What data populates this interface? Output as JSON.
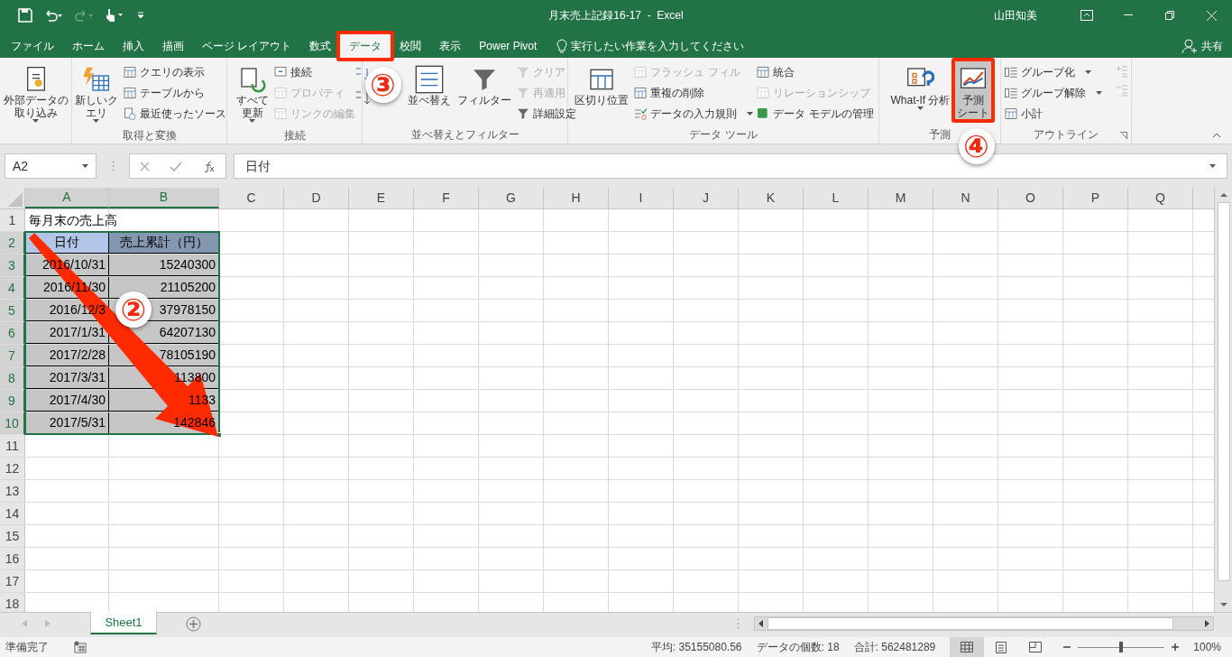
{
  "title_bar": {
    "title": "月末売上記録16-17  -  Excel",
    "user": "山田知美"
  },
  "tabs": [
    {
      "label": "ファイル",
      "selected": false
    },
    {
      "label": "ホーム",
      "selected": false
    },
    {
      "label": "挿入",
      "selected": false
    },
    {
      "label": "描画",
      "selected": false
    },
    {
      "label": "ページ レイアウト",
      "selected": false
    },
    {
      "label": "数式",
      "selected": false
    },
    {
      "label": "データ",
      "selected": true
    },
    {
      "label": "校閲",
      "selected": false
    },
    {
      "label": "表示",
      "selected": false
    },
    {
      "label": "Power Pivot",
      "selected": false
    }
  ],
  "tell_me": "実行したい作業を入力してください",
  "share": "共有",
  "ribbon": {
    "groups": [
      {
        "columns": [
          {
            "kind": "large",
            "lines": [
              "外部データの",
              "取り込み"
            ],
            "dropdown": true
          }
        ]
      },
      {
        "label": "取得と変換",
        "columns": [
          {
            "kind": "large",
            "lines": [
              "新しいク",
              "エリ"
            ],
            "dropdown": true
          },
          {
            "kind": "stack",
            "items": [
              {
                "label": "クエリの表示",
                "disabled": false,
                "dropdown": false
              },
              {
                "label": "テーブルから",
                "disabled": false,
                "dropdown": false
              },
              {
                "label": "最近使ったソース",
                "disabled": false,
                "dropdown": false
              }
            ]
          }
        ]
      },
      {
        "label": "接続",
        "columns": [
          {
            "kind": "large",
            "lines": [
              "すべて",
              "更新"
            ],
            "dropdown": true
          },
          {
            "kind": "stack",
            "items": [
              {
                "label": "接続",
                "disabled": false,
                "dropdown": false
              },
              {
                "label": "プロパティ",
                "disabled": true,
                "dropdown": false
              },
              {
                "label": "リンクの編集",
                "disabled": true,
                "dropdown": false
              }
            ]
          }
        ]
      },
      {
        "label": "並べ替えとフィルター",
        "columns": [
          {
            "kind": "sorticons"
          },
          {
            "kind": "large",
            "lines": [
              "並べ替え"
            ],
            "dropdown": false
          },
          {
            "kind": "large",
            "lines": [
              "フィルター"
            ],
            "dropdown": false
          },
          {
            "kind": "stack",
            "items": [
              {
                "label": "クリア",
                "disabled": true,
                "dropdown": false
              },
              {
                "label": "再適用",
                "disabled": true,
                "dropdown": false
              },
              {
                "label": "詳細設定",
                "disabled": false,
                "dropdown": false
              }
            ]
          }
        ]
      },
      {
        "label": "データ ツール",
        "columns": [
          {
            "kind": "large",
            "lines": [
              "区切り位置"
            ],
            "dropdown": false
          },
          {
            "kind": "stack",
            "items": [
              {
                "label": "フラッシュ フィル",
                "disabled": true,
                "dropdown": false
              },
              {
                "label": "重複の削除",
                "disabled": false,
                "dropdown": false
              },
              {
                "label": "データの入力規則",
                "disabled": false,
                "dropdown": true
              }
            ]
          },
          {
            "kind": "stack",
            "items": [
              {
                "label": "統合",
                "disabled": false,
                "dropdown": false
              },
              {
                "label": "リレーションシップ",
                "disabled": true,
                "dropdown": false
              },
              {
                "label": "データ モデルの管理",
                "disabled": false,
                "dropdown": false
              }
            ]
          }
        ]
      },
      {
        "label": "予測",
        "columns": [
          {
            "kind": "large",
            "lines": [
              "What-If 分析"
            ],
            "dropdown": true
          },
          {
            "kind": "large",
            "lines": [
              "予測",
              "シート"
            ],
            "dropdown": false,
            "highlighted": true
          }
        ]
      },
      {
        "label": "アウトライン",
        "launcher": true,
        "columns": [
          {
            "kind": "stack",
            "items": [
              {
                "label": "グループ化",
                "disabled": false,
                "dropdown": true
              },
              {
                "label": "グループ解除",
                "disabled": false,
                "dropdown": true
              },
              {
                "label": "小計",
                "disabled": false,
                "dropdown": false
              }
            ]
          },
          {
            "kind": "iconstack"
          }
        ]
      }
    ]
  },
  "formula_bar": {
    "name_box": "A2",
    "formula": "日付"
  },
  "sheet": {
    "columns": [
      {
        "label": "A",
        "selected": true
      },
      {
        "label": "B",
        "selected": true
      },
      {
        "label": "C",
        "selected": false
      },
      {
        "label": "D",
        "selected": false
      },
      {
        "label": "E",
        "selected": false
      },
      {
        "label": "F",
        "selected": false
      },
      {
        "label": "G",
        "selected": false
      },
      {
        "label": "H",
        "selected": false
      },
      {
        "label": "I",
        "selected": false
      },
      {
        "label": "J",
        "selected": false
      },
      {
        "label": "K",
        "selected": false
      },
      {
        "label": "L",
        "selected": false
      },
      {
        "label": "M",
        "selected": false
      },
      {
        "label": "N",
        "selected": false
      },
      {
        "label": "O",
        "selected": false
      },
      {
        "label": "P",
        "selected": false
      },
      {
        "label": "Q",
        "selected": false
      }
    ],
    "rows": [
      {
        "number": "1",
        "selected": false,
        "cells": [
          {
            "kind": "title",
            "text": "毎月末の売上高"
          }
        ]
      },
      {
        "number": "2",
        "selected": true,
        "cells": [
          {
            "kind": "header",
            "text": "日付"
          },
          {
            "kind": "header",
            "text": "売上累計（円）"
          }
        ]
      },
      {
        "number": "3",
        "selected": true,
        "cells": [
          {
            "kind": "value",
            "text": "2016/10/31"
          },
          {
            "kind": "value",
            "text": "15240300"
          }
        ]
      },
      {
        "number": "4",
        "selected": true,
        "cells": [
          {
            "kind": "value",
            "text": "2016/11/30"
          },
          {
            "kind": "value",
            "text": "21105200"
          }
        ]
      },
      {
        "number": "5",
        "selected": true,
        "cells": [
          {
            "kind": "value",
            "text": "2016/12/3"
          },
          {
            "kind": "value",
            "text": "37978150"
          }
        ]
      },
      {
        "number": "6",
        "selected": true,
        "cells": [
          {
            "kind": "value",
            "text": "2017/1/31"
          },
          {
            "kind": "value",
            "text": "64207130"
          }
        ]
      },
      {
        "number": "7",
        "selected": true,
        "cells": [
          {
            "kind": "value",
            "text": "2017/2/28"
          },
          {
            "kind": "value",
            "text": "78105190"
          }
        ]
      },
      {
        "number": "8",
        "selected": true,
        "cells": [
          {
            "kind": "value",
            "text": "2017/3/31"
          },
          {
            "kind": "value",
            "text": "113800"
          }
        ]
      },
      {
        "number": "9",
        "selected": true,
        "cells": [
          {
            "kind": "value",
            "text": "2017/4/30"
          },
          {
            "kind": "value",
            "text": "1133"
          }
        ]
      },
      {
        "number": "10",
        "selected": true,
        "cells": [
          {
            "kind": "value",
            "text": "2017/5/31"
          },
          {
            "kind": "value",
            "text": "142846"
          }
        ]
      },
      {
        "number": "11",
        "selected": false,
        "cells": []
      },
      {
        "number": "12",
        "selected": false,
        "cells": []
      },
      {
        "number": "13",
        "selected": false,
        "cells": []
      },
      {
        "number": "14",
        "selected": false,
        "cells": []
      },
      {
        "number": "15",
        "selected": false,
        "cells": []
      },
      {
        "number": "16",
        "selected": false,
        "cells": []
      },
      {
        "number": "17",
        "selected": false,
        "cells": []
      },
      {
        "number": "18",
        "selected": false,
        "cells": []
      }
    ]
  },
  "sheet_tabs": [
    {
      "label": "Sheet1",
      "selected": true
    }
  ],
  "status_bar": {
    "status": "準備完了",
    "stats": [
      "平均: 35155080.56",
      "データの個数: 18",
      "合計: 562481289"
    ],
    "views": [
      {
        "kind": "normal",
        "selected": true
      },
      {
        "kind": "layout",
        "selected": false
      },
      {
        "kind": "pagebreak",
        "selected": false
      }
    ],
    "zoom": {
      "level": 0.5,
      "label": "100%"
    }
  },
  "annotations": [
    {
      "kind": "step",
      "label": "②"
    },
    {
      "kind": "step",
      "label": "③"
    },
    {
      "kind": "step",
      "label": "④"
    },
    {
      "kind": "arrow"
    },
    {
      "kind": "box"
    },
    {
      "kind": "box"
    }
  ]
}
